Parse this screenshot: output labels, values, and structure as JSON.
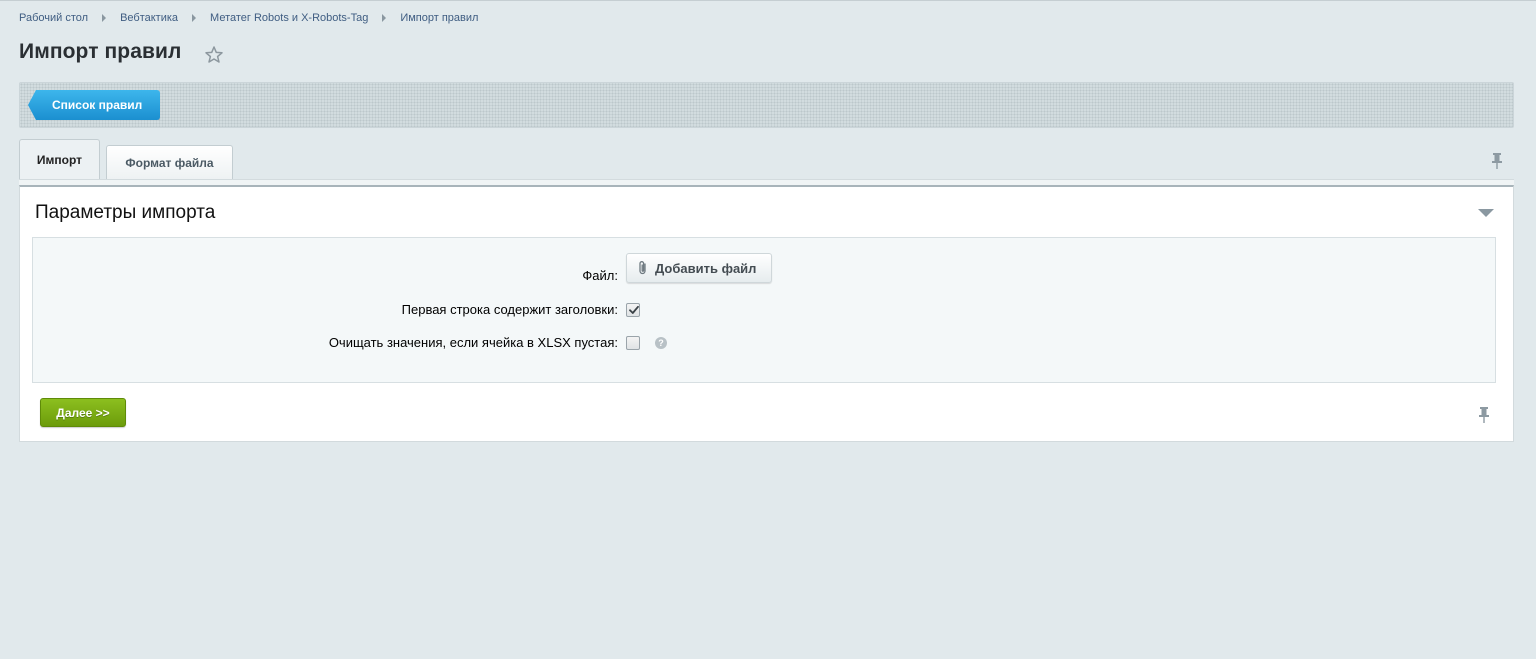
{
  "breadcrumb": {
    "items": [
      "Рабочий стол",
      "Вебтактика",
      "Метатег Robots и X-Robots-Tag",
      "Импорт правил"
    ]
  },
  "page": {
    "title": "Импорт правил"
  },
  "toolbar": {
    "list_button_label": "Список правил"
  },
  "tabs": {
    "items": [
      {
        "label": "Импорт",
        "active": true
      },
      {
        "label": "Формат файла",
        "active": false
      }
    ]
  },
  "section": {
    "title": "Параметры импорта"
  },
  "form": {
    "file_label": "Файл:",
    "add_file_label": "Добавить файл",
    "first_row_label": "Первая строка содержит заголовки:",
    "first_row_checked": true,
    "clear_values_label": "Очищать значения, если ячейка в XLSX пустая:",
    "clear_values_checked": false,
    "help_glyph": "?"
  },
  "actions": {
    "next_label": "Далее >>"
  },
  "colors": {
    "accent_blue": "#1b8fd0",
    "accent_green": "#7aab12",
    "background": "#e1e9ec"
  },
  "icons": [
    "star-icon",
    "pin-icon",
    "collapse-arrow-icon",
    "paperclip-icon",
    "check-icon",
    "help-icon"
  ]
}
